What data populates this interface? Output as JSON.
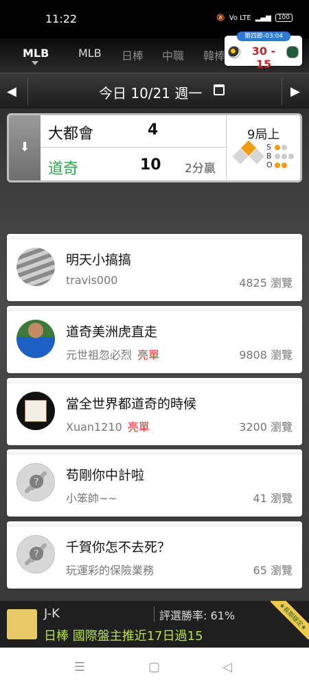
{
  "status": {
    "time": "11:22",
    "battery": "100",
    "icons": [
      "mute-icon",
      "volte-icon",
      "signal-icon",
      "battery-icon"
    ]
  },
  "tabs": [
    {
      "label": "MLB",
      "active": true
    },
    {
      "label": "MLB",
      "active": false
    },
    {
      "label": "日棒",
      "active": false
    },
    {
      "label": "中職",
      "active": false
    },
    {
      "label": "韓棒",
      "active": false
    }
  ],
  "score_widget": {
    "period": "第四節-03:04",
    "score": "30 - 15"
  },
  "date_bar": {
    "label": "今日 10/21 週一"
  },
  "game": {
    "away": {
      "name": "大都會",
      "score": "4"
    },
    "home": {
      "name": "道奇",
      "score": "10"
    },
    "result": "2分贏",
    "inning": "9局上",
    "sbo": [
      "S",
      "B",
      "O"
    ]
  },
  "posts": [
    {
      "title": "明天小搞搞",
      "author": "travis000",
      "badge": "",
      "views": "4825 瀏覽"
    },
    {
      "title": "道奇美洲虎直走",
      "author": "元世祖忽必烈",
      "badge": "亮單",
      "views": "9808 瀏覽"
    },
    {
      "title": "當全世界都道奇的時候",
      "author": "Xuan1210",
      "badge": "亮單",
      "views": "3200 瀏覽"
    },
    {
      "title": "苟剛你中計啦",
      "author": "小笨帥~~",
      "badge": "",
      "views": "41 瀏覽"
    },
    {
      "title": "千賀你怎不去死？",
      "author": "玩運彩的保險業務",
      "badge": "",
      "views": "65 瀏覽"
    }
  ],
  "banner": {
    "user": "J-K",
    "win_rate": "評選勝率: 61%",
    "pick": "日棒 國際盤主推近17日過15",
    "ribbon": "★長期穩定★"
  },
  "colors": {
    "accent_green": "#2aa84a",
    "badge_red": "#e0362e",
    "score_red": "#c4242a",
    "base_orange": "#f39c12"
  }
}
